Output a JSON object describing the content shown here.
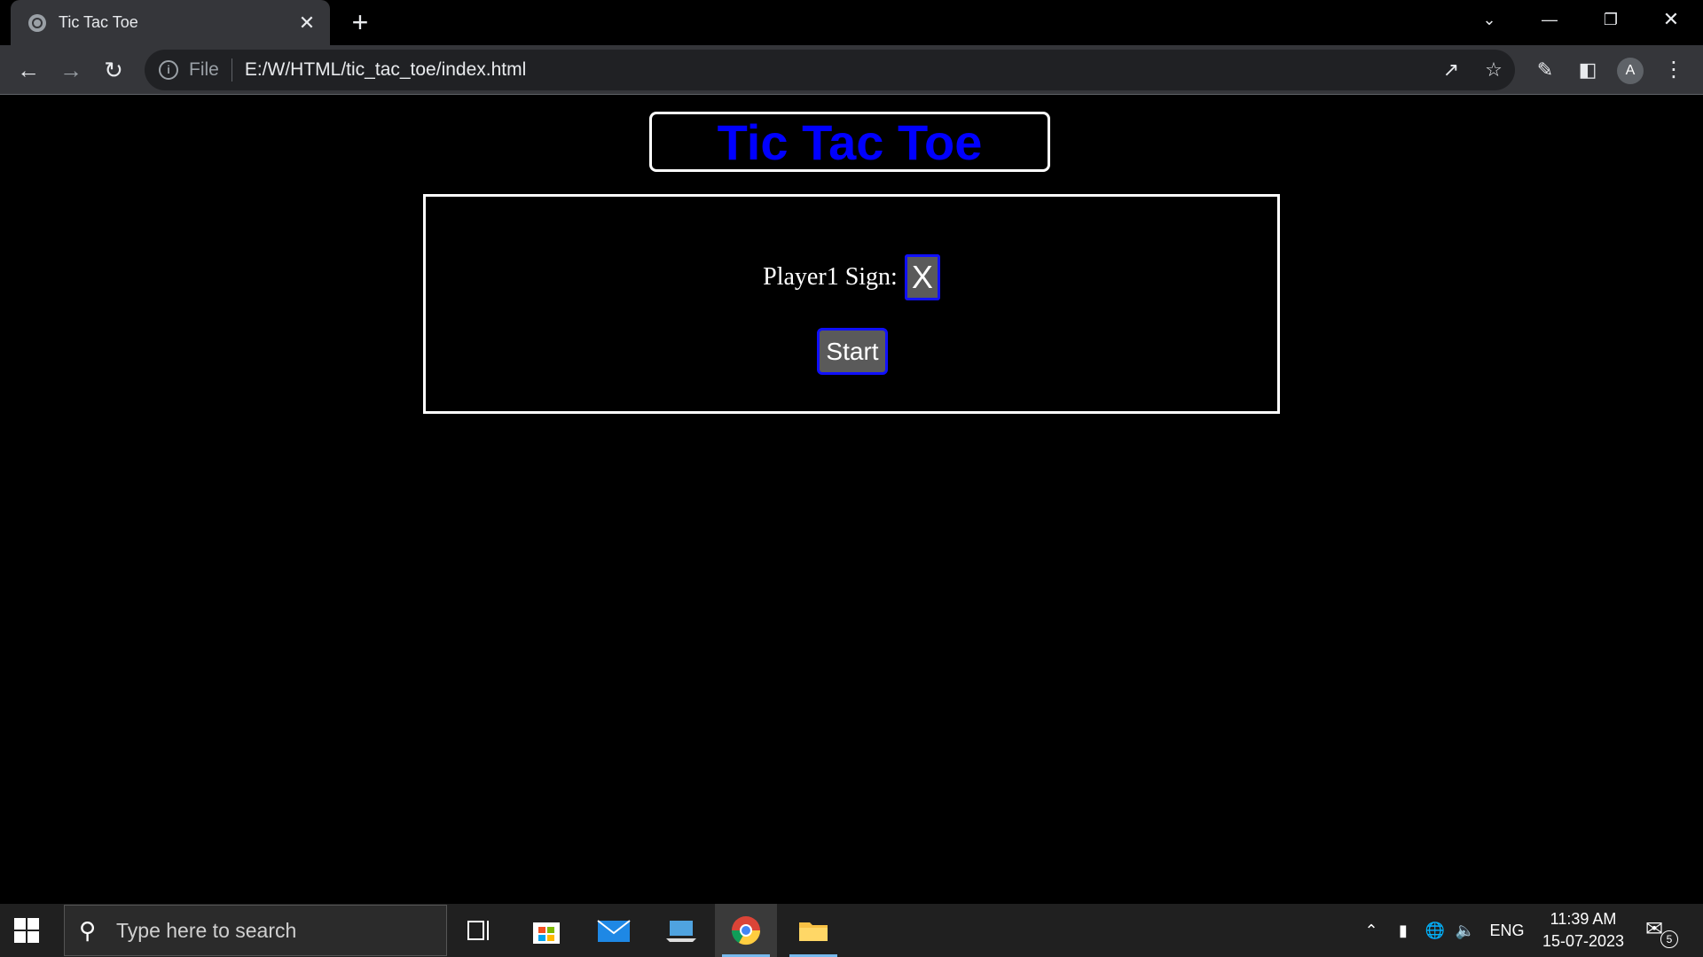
{
  "browser": {
    "tab_title": "Tic Tac Toe",
    "tab_close": "✕",
    "new_tab": "+",
    "url_scheme": "File",
    "url": "E:/W/HTML/tic_tac_toe/index.html",
    "profile_initial": "A"
  },
  "page": {
    "title": "Tic Tac Toe",
    "sign_label": "Player1 Sign:",
    "sign_value": "X",
    "start_label": "Start"
  },
  "taskbar": {
    "search_placeholder": "Type here to search",
    "language": "ENG",
    "time": "11:39 AM",
    "date": "15-07-2023",
    "notification_count": "5"
  },
  "colors": {
    "title_text": "#0000ff",
    "control_border": "#1010ff",
    "control_bg": "#5a5a5a",
    "page_bg": "#000000"
  },
  "icons": [
    "globe-icon",
    "back-icon",
    "forward-icon",
    "reload-icon",
    "info-icon",
    "share-icon",
    "star-icon",
    "extensions-icon",
    "sidepanel-icon",
    "menu-icon",
    "windows-icon",
    "search-icon",
    "task-view-icon",
    "store-icon",
    "mail-icon",
    "laptop-icon",
    "chrome-icon",
    "folder-icon"
  ]
}
